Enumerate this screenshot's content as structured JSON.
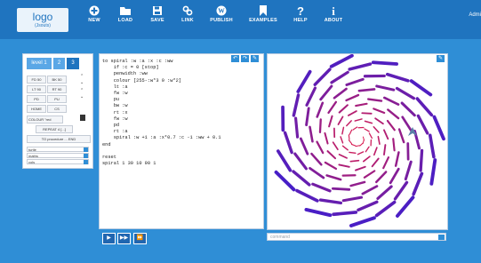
{
  "logo": {
    "main": "logo",
    "sub": "(Jsouts)"
  },
  "nav": [
    {
      "label": "NEW",
      "icon": "plus-circle-icon"
    },
    {
      "label": "LOAD",
      "icon": "folder-icon"
    },
    {
      "label": "SAVE",
      "icon": "floppy-icon"
    },
    {
      "label": "LINK",
      "icon": "link-icon"
    },
    {
      "label": "PUBLISH",
      "icon": "wordpress-icon"
    },
    {
      "label": "EXAMPLES",
      "icon": "bookmark-icon"
    },
    {
      "label": "HELP",
      "icon": "question-icon"
    },
    {
      "label": "ABOUT",
      "icon": "info-icon"
    }
  ],
  "admin": "Admi",
  "levels": [
    "level 1",
    "2",
    "3"
  ],
  "commands": [
    [
      "FD 50",
      "BK 50"
    ],
    [
      "LT 90",
      "RT 90"
    ],
    [
      "PD",
      "PU"
    ],
    [
      "HOME",
      "CS"
    ]
  ],
  "colour": "COLOUR \"red",
  "repeat": "REPEAT 4 [...]",
  "procedure": "TO procedure ... END",
  "selects": [
    "turtle",
    "maths",
    "cols"
  ],
  "code": "to spiral :w :a :x :c :ww\n    if :c = 0 [stop]\n    penwidth :ww\n    colour [255-:w*3 0 :w*2]\n    lt :a\n    fw :w\n    pu\n    bw :w\n    rt :x\n    fw :w\n    pd\n    rt :a\n    spiral :w +1 :a :x*0.7 :c -1 :ww + 0.1\nend\n\nreset\nspiral 1 30 10 90 1",
  "command_placeholder": "command",
  "colors": {
    "header": "#1f74bf",
    "background": "#2f8ed6",
    "accent": "#2f8ed6"
  }
}
